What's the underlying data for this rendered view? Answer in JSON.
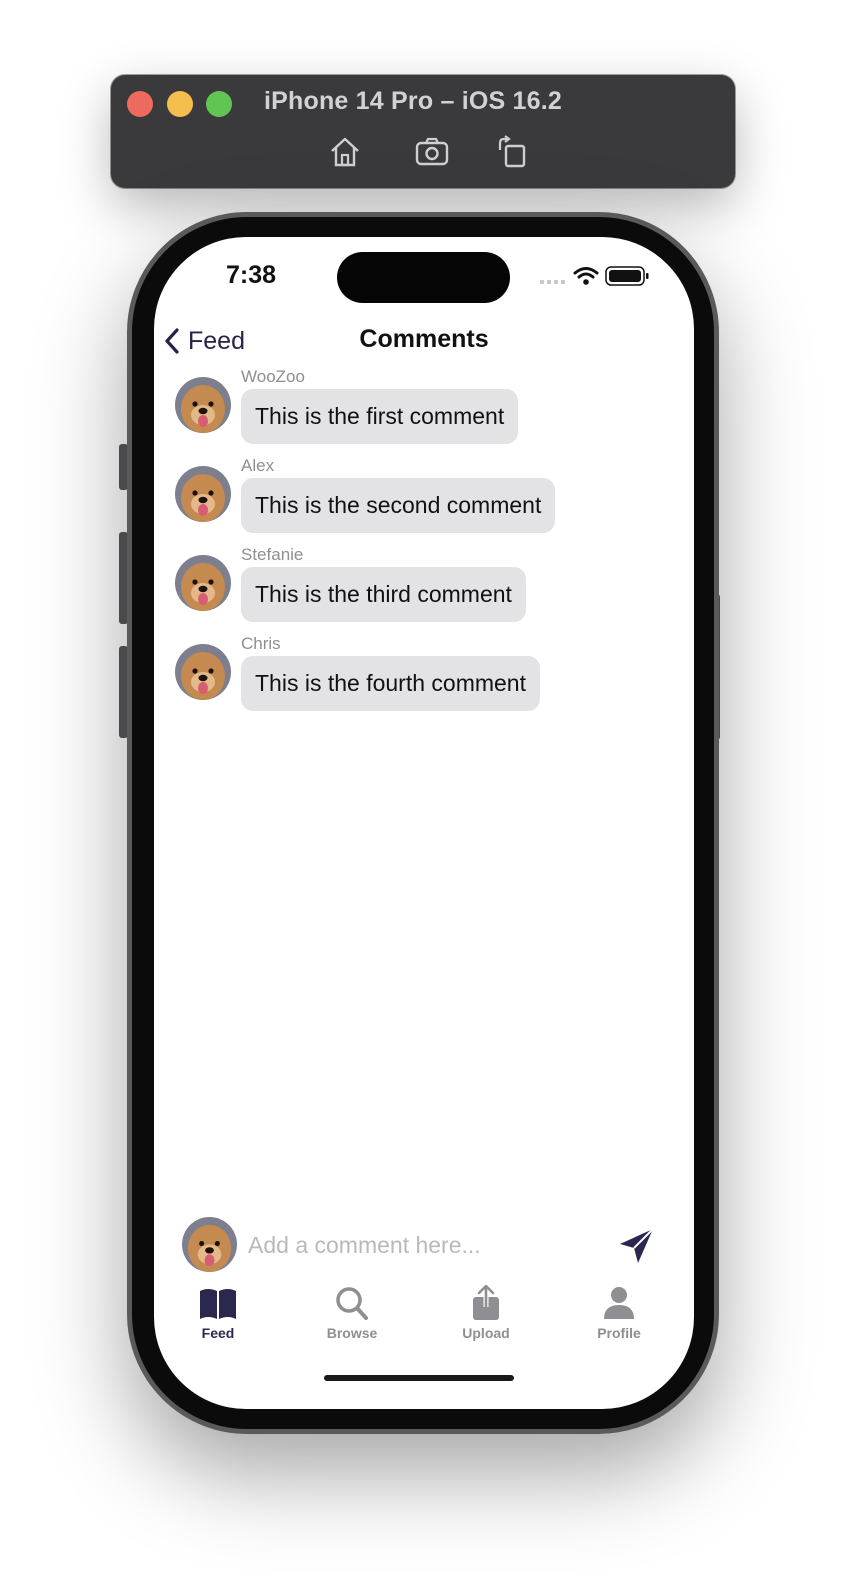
{
  "simulator": {
    "title": "iPhone 14 Pro – iOS 16.2",
    "buttons": [
      "home-icon",
      "screenshot-icon",
      "rotate-icon"
    ]
  },
  "status_bar": {
    "time": "7:38"
  },
  "nav": {
    "back_label": "Feed",
    "title": "Comments"
  },
  "comments": [
    {
      "user": "WooZoo",
      "text": "This is the first comment"
    },
    {
      "user": "Alex",
      "text": "This is the second comment"
    },
    {
      "user": "Stefanie",
      "text": "This is the third comment"
    },
    {
      "user": "Chris",
      "text": "This is the fourth comment"
    }
  ],
  "composer": {
    "placeholder": "Add a comment here..."
  },
  "tabs": [
    {
      "label": "Feed",
      "icon": "book-icon",
      "active": true
    },
    {
      "label": "Browse",
      "icon": "search-icon",
      "active": false
    },
    {
      "label": "Upload",
      "icon": "upload-icon",
      "active": false
    },
    {
      "label": "Profile",
      "icon": "person-icon",
      "active": false
    }
  ],
  "colors": {
    "accent": "#2b2850",
    "bubble": "#e3e3e6",
    "inactive_tab": "#8e8e93"
  }
}
